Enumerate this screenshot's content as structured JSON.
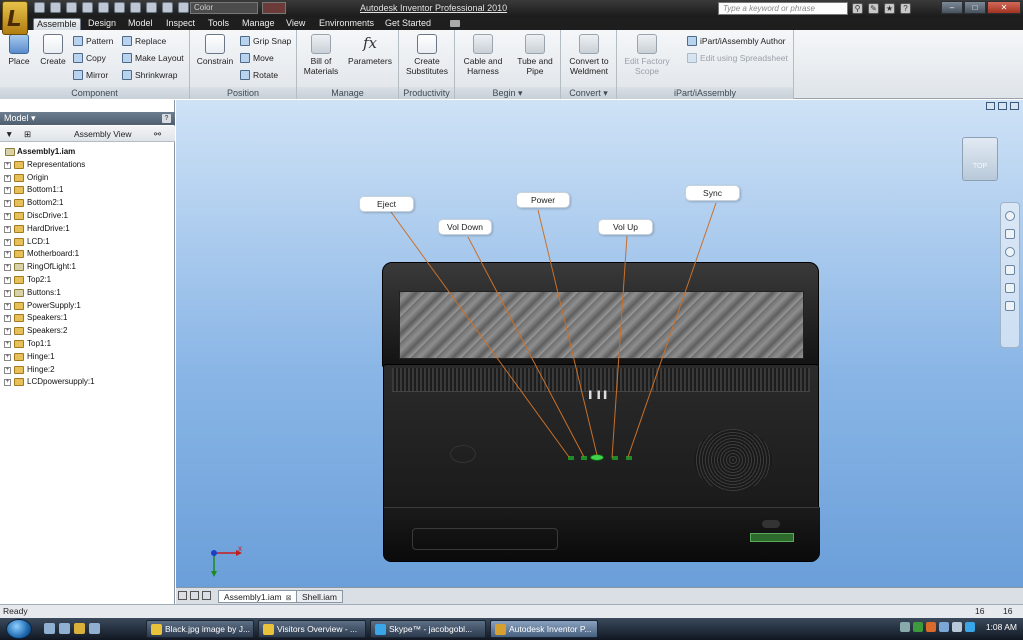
{
  "title_bar": {
    "app_title": "Autodesk Inventor Professional 2010",
    "color_dropdown": "Color",
    "search_placeholder": "Type a keyword or phrase",
    "minimize": "–",
    "restore": "□",
    "close": "✕"
  },
  "tabs": [
    {
      "label": "Assemble",
      "active": true
    },
    {
      "label": "Design"
    },
    {
      "label": "Model"
    },
    {
      "label": "Inspect"
    },
    {
      "label": "Tools"
    },
    {
      "label": "Manage"
    },
    {
      "label": "View"
    },
    {
      "label": "Environments"
    },
    {
      "label": "Get Started"
    }
  ],
  "ribbon": {
    "component": {
      "title": "Component",
      "place": "Place",
      "create": "Create",
      "pattern": "Pattern",
      "copy": "Copy",
      "mirror": "Mirror",
      "replace": "Replace",
      "make_layout": "Make Layout",
      "shrinkwrap": "Shrinkwrap"
    },
    "position": {
      "title": "Position",
      "constrain": "Constrain",
      "grip_snap": "Grip Snap",
      "move": "Move",
      "rotate": "Rotate"
    },
    "manage": {
      "title": "Manage",
      "bill_of_materials_1": "Bill of",
      "bill_of_materials_2": "Materials",
      "parameters": "Parameters"
    },
    "productivity": {
      "title": "Productivity",
      "create_substitutes_1": "Create",
      "create_substitutes_2": "Substitutes"
    },
    "begin": {
      "title": "Begin ▾",
      "cable_1": "Cable and",
      "cable_2": "Harness",
      "tube_1": "Tube and",
      "tube_2": "Pipe"
    },
    "convert": {
      "title": "Convert ▾",
      "convert_1": "Convert to",
      "convert_2": "Weldment"
    },
    "ipart": {
      "title": "iPart/iAssembly",
      "edit_factory_1": "Edit Factory",
      "edit_factory_2": "Scope",
      "author": "iPart/iAssembly Author",
      "edit_spreadsheet": "Edit using Spreadsheet"
    }
  },
  "browser": {
    "header": "Model ▾",
    "help": "?",
    "view_dropdown": "Assembly View",
    "root": "Assembly1.iam",
    "items": [
      "Representations",
      "Origin",
      "Bottom1:1",
      "Bottom2:1",
      "DiscDrive:1",
      "HardDrive:1",
      "LCD:1",
      "Motherboard:1",
      "RingOfLight:1",
      "Top2:1",
      "Buttons:1",
      "PowerSupply:1",
      "Speakers:1",
      "Speakers:2",
      "Top1:1",
      "Hinge:1",
      "Hinge:2",
      "LCDpowersupply:1"
    ]
  },
  "viewport": {
    "viewcube_face": "TOP",
    "callouts": {
      "eject": "Eject",
      "vol_down": "Vol Down",
      "power": "Power",
      "vol_up": "Vol Up",
      "sync": "Sync"
    },
    "leader_color": "#c8702a",
    "triad_x": "x"
  },
  "doc_tabs": [
    {
      "label": "Assembly1.iam",
      "active": true
    },
    {
      "label": "Shell.iam",
      "active": false
    }
  ],
  "status": {
    "text": "Ready",
    "num1": "16",
    "num2": "16"
  },
  "taskbar": {
    "items": [
      "Black.jpg image by J...",
      "Visitors Overview - ...",
      "Skype™ - jacobgobl...",
      "Autodesk Inventor P..."
    ],
    "clock": "1:08 AM"
  }
}
